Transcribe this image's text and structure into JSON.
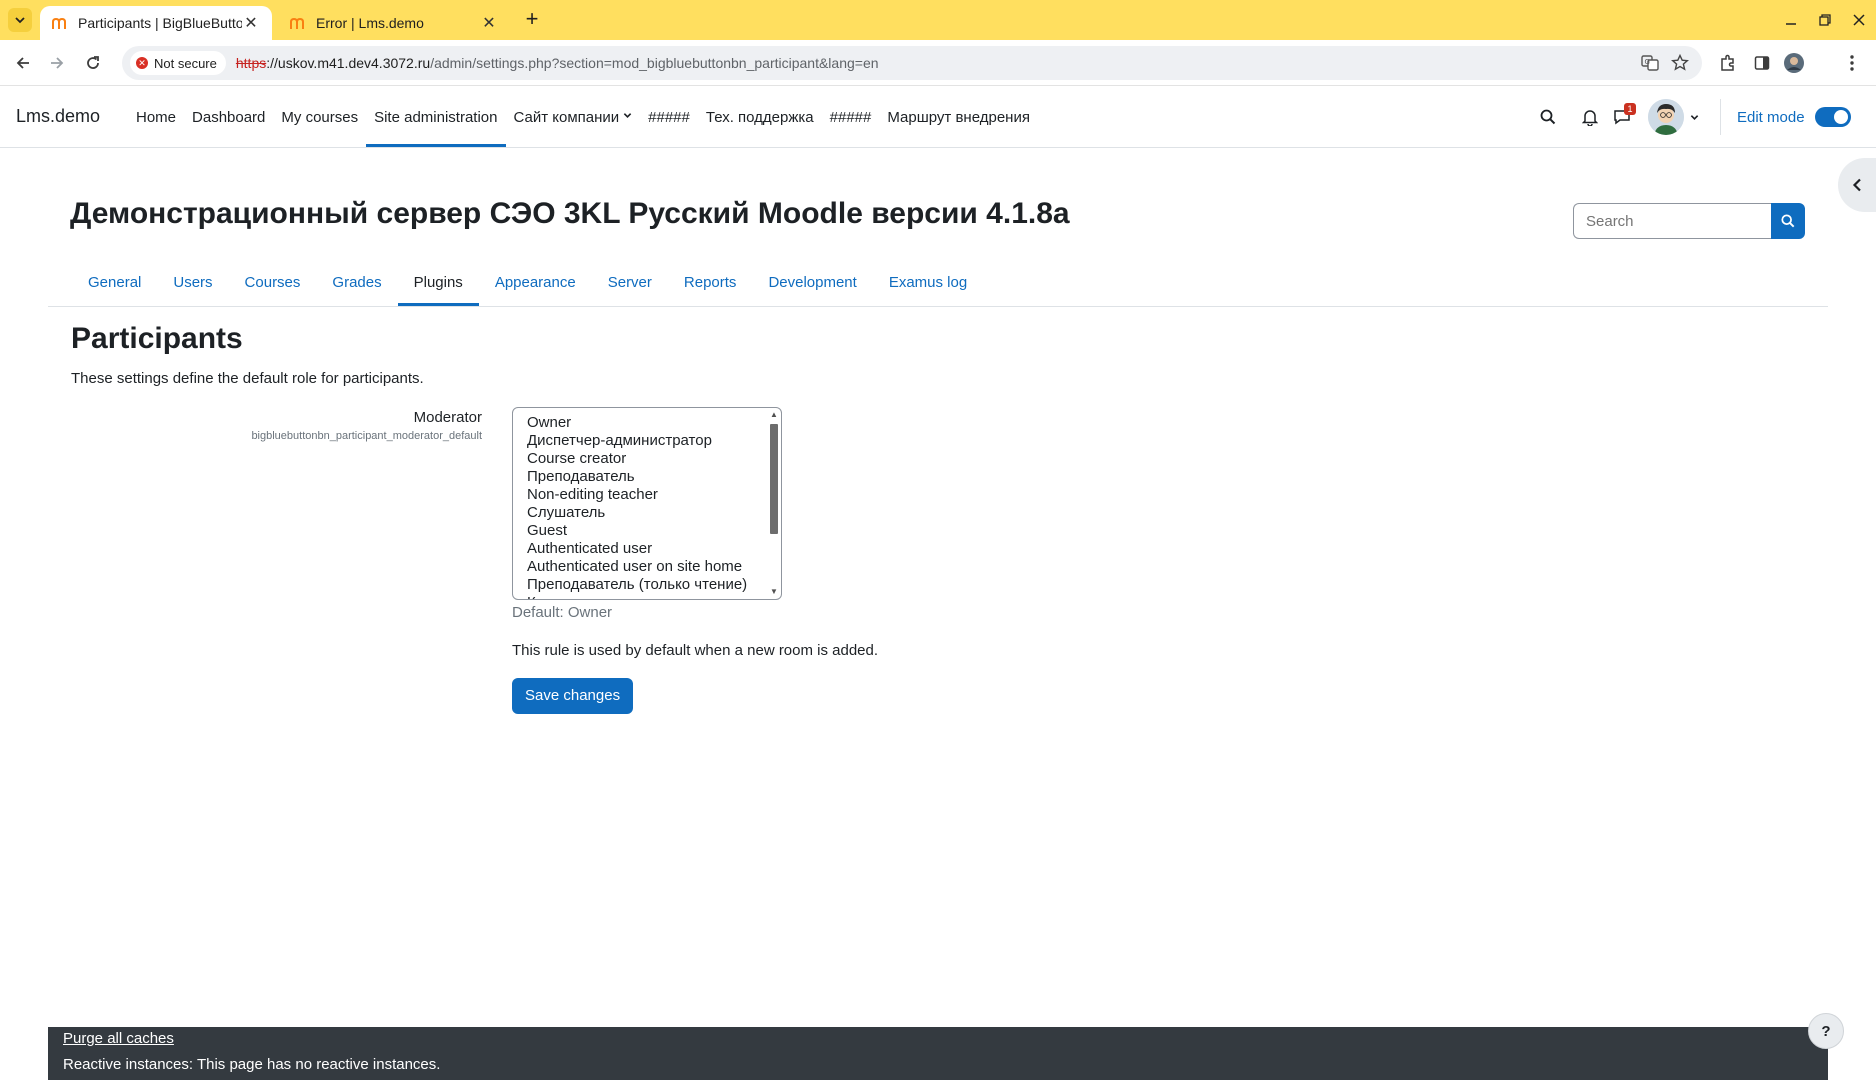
{
  "browser": {
    "tabs": [
      {
        "title": "Participants | BigBlueButton",
        "active": true
      },
      {
        "title": "Error | Lms.demo",
        "active": false
      }
    ],
    "security_label": "Not secure",
    "url_scheme": "https",
    "url_host": "://uskov.m41.dev4.3072.ru",
    "url_path": "/admin/settings.php?section=mod_bigbluebuttonbn_participant&lang=en"
  },
  "navbar": {
    "brand": "Lms.demo",
    "items": [
      {
        "label": "Home"
      },
      {
        "label": "Dashboard"
      },
      {
        "label": "My courses"
      },
      {
        "label": "Site administration"
      },
      {
        "label": "Сайт компании"
      },
      {
        "label": "#####"
      },
      {
        "label": "Тех. поддержка"
      },
      {
        "label": "#####"
      },
      {
        "label": "Маршрут внедрения"
      }
    ],
    "message_count": "1",
    "edit_mode_label": "Edit mode"
  },
  "header": {
    "title": "Демонстрационный сервер СЭО 3KL Русский Moodle версии 4.1.8a",
    "search_placeholder": "Search"
  },
  "secondary_nav": [
    {
      "label": "General"
    },
    {
      "label": "Users"
    },
    {
      "label": "Courses"
    },
    {
      "label": "Grades"
    },
    {
      "label": "Plugins"
    },
    {
      "label": "Appearance"
    },
    {
      "label": "Server"
    },
    {
      "label": "Reports"
    },
    {
      "label": "Development"
    },
    {
      "label": "Examus log"
    }
  ],
  "settings": {
    "heading": "Participants",
    "description": "These settings define the default role for participants.",
    "field_label": "Moderator",
    "field_key": "bigbluebuttonbn_participant_moderator_default",
    "options": [
      "Owner",
      "Диспетчер-администратор",
      "Course creator",
      "Преподаватель",
      "Non-editing teacher",
      "Слушатель",
      "Guest",
      "Authenticated user",
      "Authenticated user on site home",
      "Преподаватель (только чтение)",
      "К"
    ],
    "default_note": "Default: Owner",
    "help_text": "This rule is used by default when a new room is added.",
    "save_label": "Save changes"
  },
  "footer": {
    "purge_label": "Purge all caches",
    "reactive_text": "Reactive instances: This page has no reactive instances.",
    "help_label": "?"
  }
}
